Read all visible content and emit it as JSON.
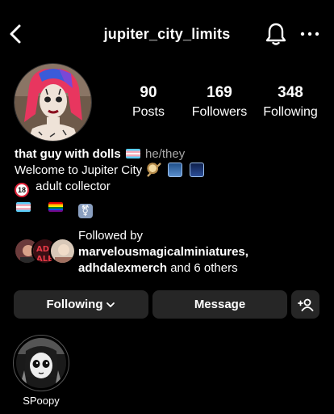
{
  "header": {
    "username": "jupiter_city_limits"
  },
  "stats": [
    {
      "count": "90",
      "label": "Posts"
    },
    {
      "count": "169",
      "label": "Followers"
    },
    {
      "count": "348",
      "label": "Following"
    }
  ],
  "bio": {
    "name": "that guy with dolls",
    "pronouns": "he/they",
    "line2": "Welcome to Jupiter City",
    "line3": "adult collector",
    "age_badge": "18"
  },
  "followed_by": {
    "prefix": "Followed by",
    "user1": "marvelousmagicalminiatures,",
    "user2": "adhdalexmerch",
    "suffix": "and 6 others"
  },
  "actions": {
    "following_label": "Following",
    "message_label": "Message"
  },
  "highlights": [
    {
      "label": "SPoopy"
    }
  ],
  "icons": {
    "back": "chevron-left-icon",
    "notifications": "bell-icon",
    "more": "more-horizontal-icon",
    "add_user": "add-person-icon"
  }
}
